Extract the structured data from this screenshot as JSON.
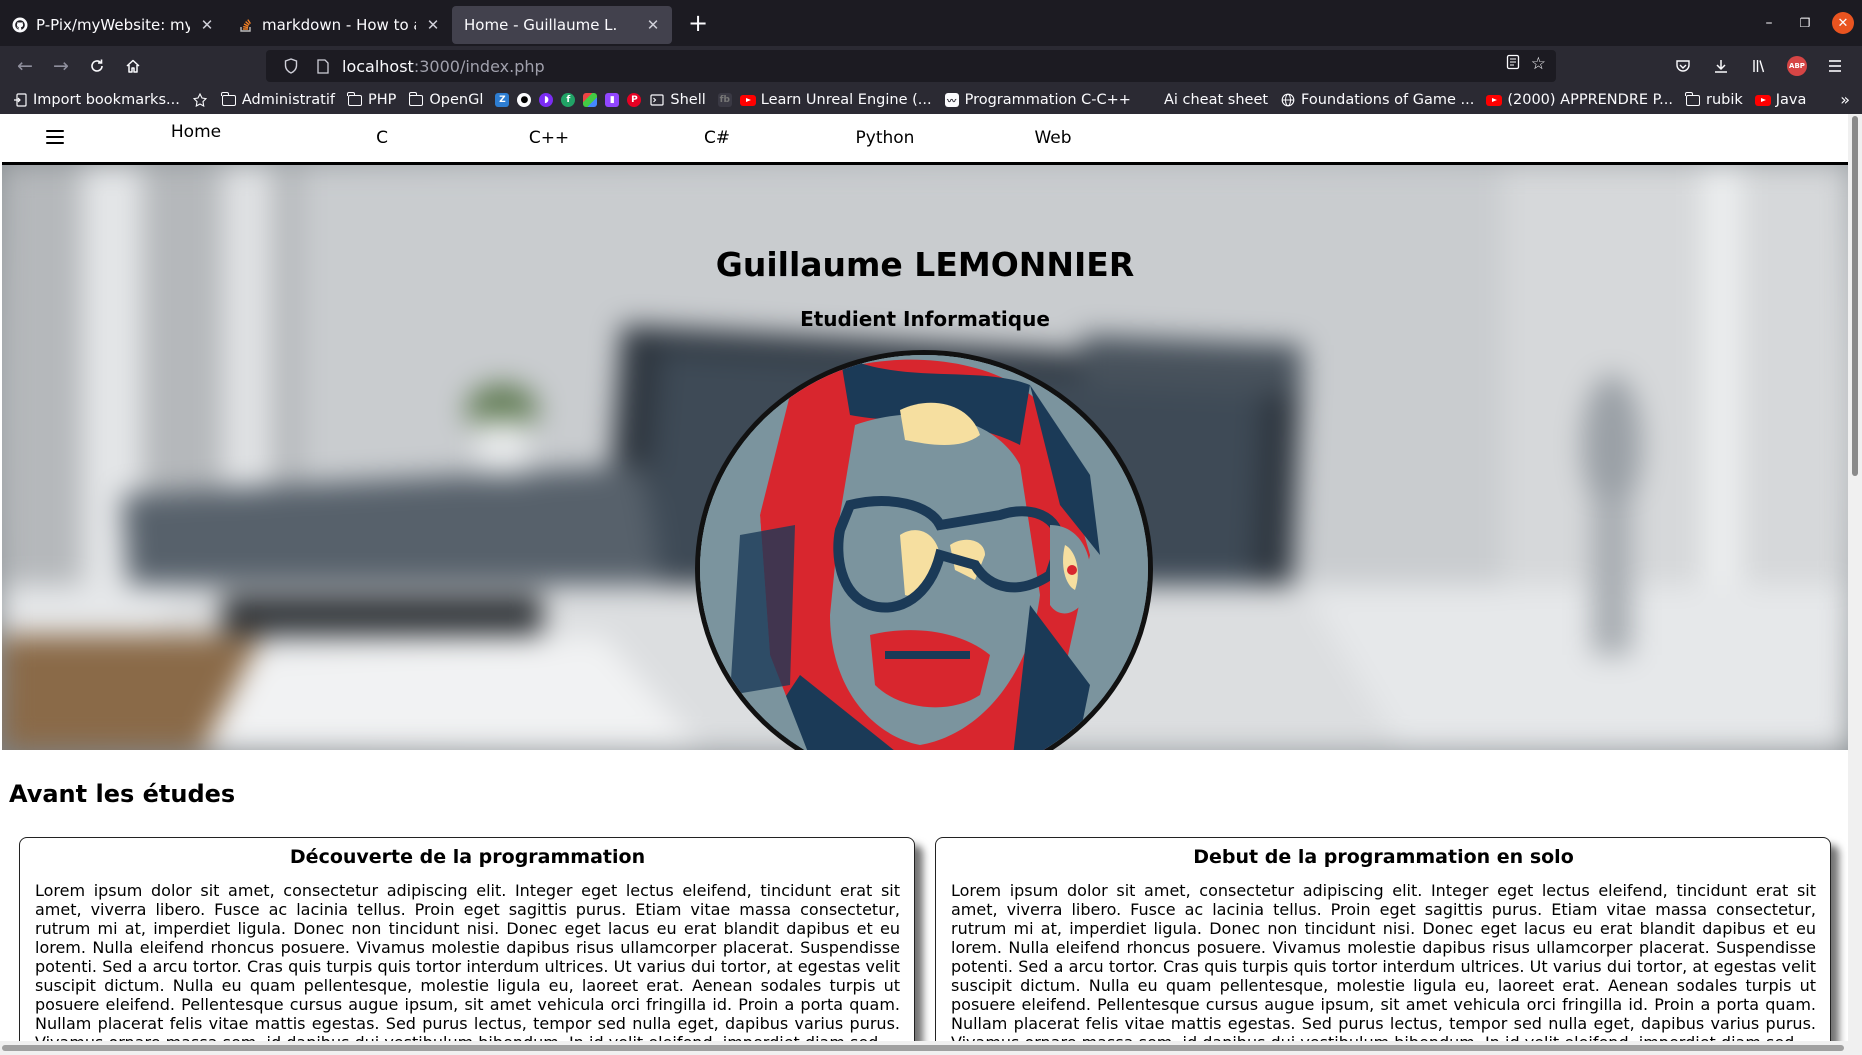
{
  "browser": {
    "tabs": [
      {
        "title": "P-Pix/myWebsite: my per",
        "icon": "github-icon",
        "active": false
      },
      {
        "title": "markdown - How to add i",
        "icon": "stackoverflow-icon",
        "active": false
      },
      {
        "title": "Home - Guillaume L.",
        "icon": "",
        "active": true
      }
    ],
    "url_host": "localhost",
    "url_path": ":3000/index.php",
    "bookmarks": [
      {
        "label": "Import bookmarks...",
        "icon": "import-icon"
      },
      {
        "label": "",
        "icon": "bookmark-icon"
      },
      {
        "label": "Administratif",
        "icon": "folder-icon"
      },
      {
        "label": "PHP",
        "icon": "folder-icon"
      },
      {
        "label": "OpenGl",
        "icon": "folder-icon"
      },
      {
        "label": "Shell",
        "icon": "terminal-icon"
      },
      {
        "label": "Learn Unreal Engine (...",
        "icon": "youtube-icon"
      },
      {
        "label": "Programmation C-C++",
        "icon": "site-icon"
      },
      {
        "label": "Ai cheat sheet",
        "icon": "page-icon"
      },
      {
        "label": "Foundations of Game ...",
        "icon": "globe-icon"
      },
      {
        "label": "(2000) APPRENDRE P...",
        "icon": "youtube-icon"
      },
      {
        "label": "rubik",
        "icon": "folder-icon"
      },
      {
        "label": "Java",
        "icon": "youtube-icon"
      }
    ],
    "colors": {
      "chrome_dark": "#1c1b22",
      "toolbar": "#2b2a33",
      "close": "#e95420"
    }
  },
  "site": {
    "nav": {
      "links": [
        "Home",
        "C",
        "C++",
        "C#",
        "Python",
        "Web"
      ]
    },
    "hero": {
      "title": "Guillaume LEMONNIER",
      "subtitle": "Etudient Informatique"
    },
    "section_title": "Avant les études",
    "cards": [
      {
        "title": "Découverte de la programmation",
        "body": "Lorem ipsum dolor sit amet, consectetur adipiscing elit. Integer eget lectus eleifend, tincidunt erat sit amet, viverra libero. Fusce ac lacinia tellus. Proin eget sagittis purus. Etiam vitae massa consectetur, rutrum mi at, imperdiet ligula. Donec non tincidunt nisi. Donec eget lacus eu erat blandit dapibus et eu lorem. Nulla eleifend rhoncus posuere. Vivamus molestie dapibus risus ullamcorper placerat. Suspendisse potenti. Sed a arcu tortor. Cras quis turpis quis tortor interdum ultrices. Ut varius dui tortor, at egestas velit suscipit dictum. Nulla eu quam pellentesque, molestie ligula eu, laoreet erat. Aenean sodales turpis ut posuere eleifend. Pellentesque cursus augue ipsum, sit amet vehicula orci fringilla id. Proin a porta quam. Nullam placerat felis vitae mattis egestas. Sed purus lectus, tempor sed nulla eget, dapibus varius purus. Vivamus ornare massa sem, id dapibus dui vestibulum bibendum. In id velit eleifend, imperdiet diam sed."
      },
      {
        "title": "Debut de la programmation en solo",
        "body": "Lorem ipsum dolor sit amet, consectetur adipiscing elit. Integer eget lectus eleifend, tincidunt erat sit amet, viverra libero. Fusce ac lacinia tellus. Proin eget sagittis purus. Etiam vitae massa consectetur, rutrum mi at, imperdiet ligula. Donec non tincidunt nisi. Donec eget lacus eu erat blandit dapibus et eu lorem. Nulla eleifend rhoncus posuere. Vivamus molestie dapibus risus ullamcorper placerat. Suspendisse potenti. Sed a arcu tortor. Cras quis turpis quis tortor interdum ultrices. Ut varius dui tortor, at egestas velit suscipit dictum. Nulla eu quam pellentesque, molestie ligula eu, laoreet erat. Aenean sodales turpis ut posuere eleifend. Pellentesque cursus augue ipsum, sit amet vehicula orci fringilla id. Proin a porta quam. Nullam placerat felis vitae mattis egestas. Sed purus lectus, tempor sed nulla eget, dapibus varius purus. Vivamus ornare massa sem, id dapibus dui vestibulum bibendum. In id velit eleifend, imperdiet diam sed."
      }
    ],
    "portrait_colors": {
      "red": "#d8262e",
      "navy": "#1b3a57",
      "steel": "#7b949e",
      "cream": "#f6dfa0"
    }
  }
}
